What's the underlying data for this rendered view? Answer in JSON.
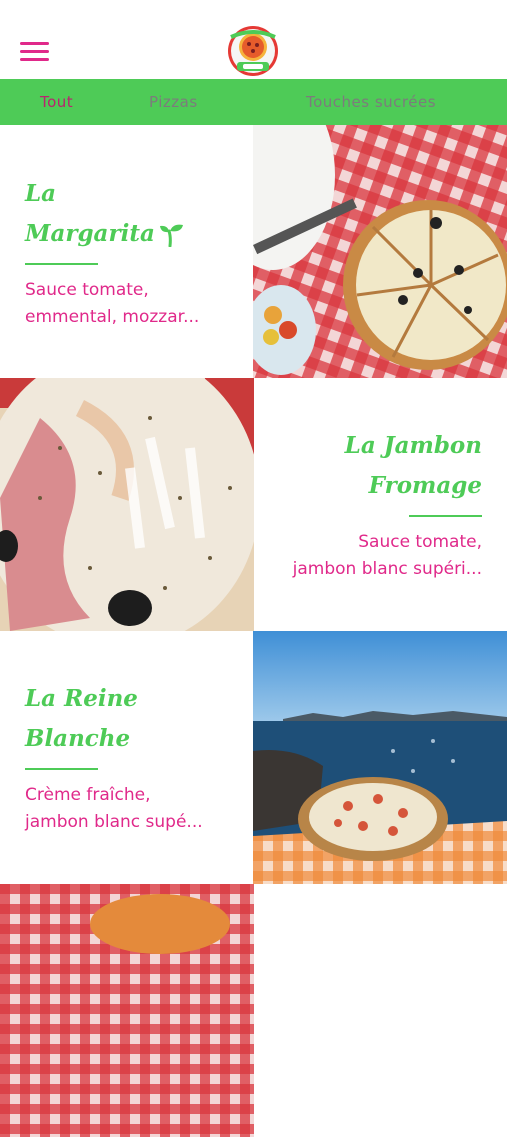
{
  "header": {
    "menu_icon": "hamburger-menu-icon",
    "logo_icon": "la-pizza-logo-icon"
  },
  "tabs": [
    {
      "label": "Tout",
      "active": true
    },
    {
      "label": "Pizzas",
      "active": false
    },
    {
      "label": "Touches sucrées",
      "active": false
    }
  ],
  "products": [
    {
      "title_line1": "La",
      "title_line2": "Margarita",
      "badge_icon": "sprout-icon",
      "description_line1": "Sauce tomate,",
      "description_line2": "emmental, mozzar..."
    },
    {
      "title_line1": "La Jambon",
      "title_line2": "Fromage",
      "description_line1": "Sauce tomate,",
      "description_line2": "jambon blanc supéri..."
    },
    {
      "title_line1": "La Reine",
      "title_line2": "Blanche",
      "description_line1": "Crème fraîche,",
      "description_line2": "jambon blanc supé..."
    }
  ],
  "colors": {
    "accent_green": "#4ecb57",
    "accent_pink": "#e0298a",
    "active_tab": "#b8246f",
    "inactive_tab": "#7c7c7c"
  }
}
